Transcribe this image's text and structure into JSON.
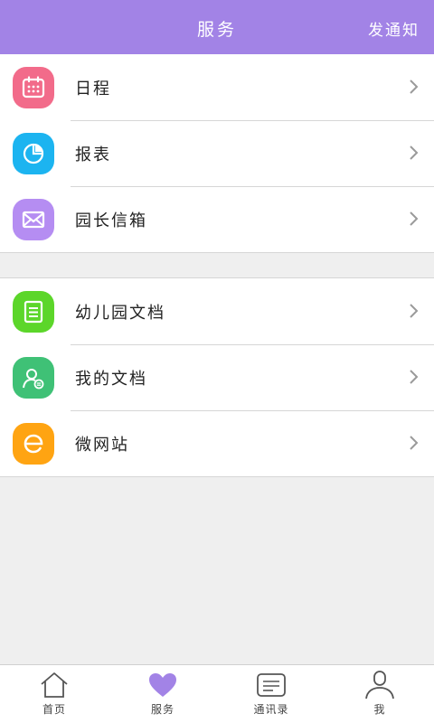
{
  "header": {
    "title": "服务",
    "action_label": "发通知",
    "bg_color": "#a283e6"
  },
  "groups": [
    {
      "items": [
        {
          "label": "日程",
          "icon": "calendar-icon",
          "color": "#f26b8a"
        },
        {
          "label": "报表",
          "icon": "pie-chart-icon",
          "color": "#1cb4f0"
        },
        {
          "label": "园长信箱",
          "icon": "mail-icon",
          "color": "#b58df2"
        }
      ]
    },
    {
      "items": [
        {
          "label": "幼儿园文档",
          "icon": "document-icon",
          "color": "#5cd62a"
        },
        {
          "label": "我的文档",
          "icon": "user-document-icon",
          "color": "#3fc176"
        },
        {
          "label": "微网站",
          "icon": "e-site-icon",
          "color": "#ffa412"
        }
      ]
    }
  ],
  "tabbar": {
    "tabs": [
      {
        "label": "首页",
        "icon": "home-icon",
        "active": false
      },
      {
        "label": "服务",
        "icon": "heart-icon",
        "active": true
      },
      {
        "label": "通讯录",
        "icon": "contacts-icon",
        "active": false
      },
      {
        "label": "我",
        "icon": "person-icon",
        "active": false
      }
    ],
    "active_color": "#a283e6"
  }
}
